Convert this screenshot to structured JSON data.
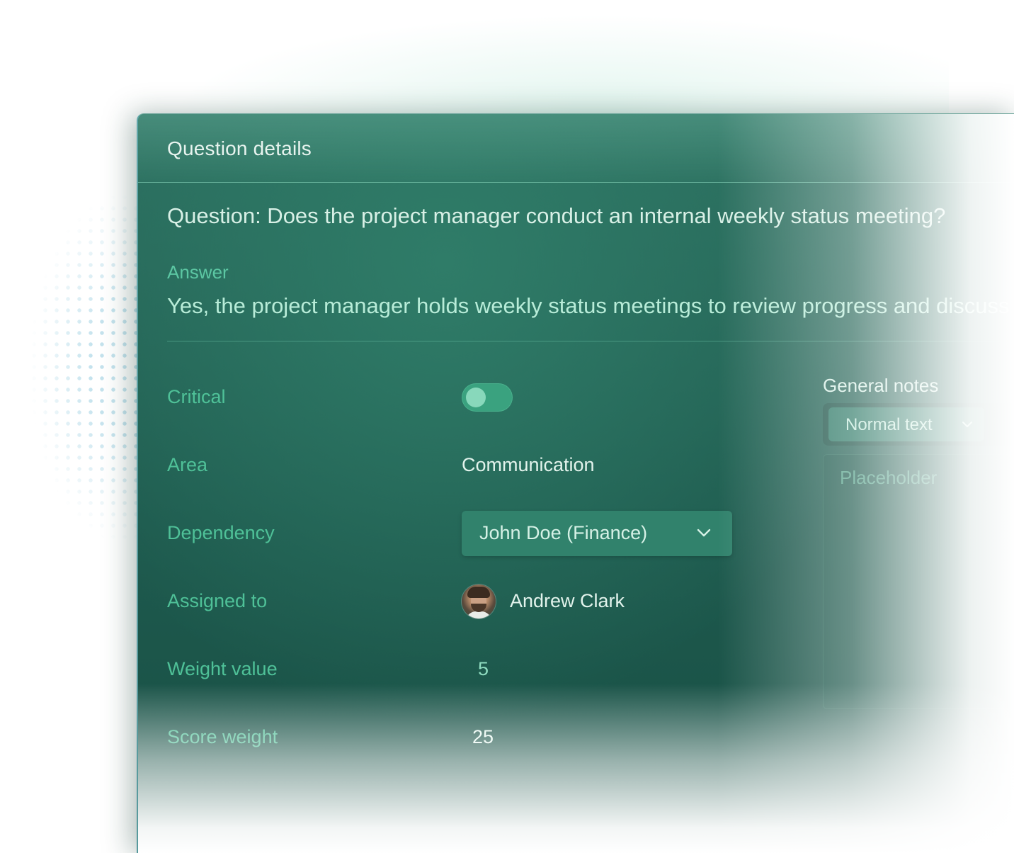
{
  "panel": {
    "title": "Question details"
  },
  "question": {
    "text": "Question: Does the project manager conduct an internal weekly status meeting?"
  },
  "answer": {
    "label": "Answer",
    "text": "Yes, the project manager holds weekly status meetings to review progress and discuss"
  },
  "fields": {
    "critical": {
      "label": "Critical",
      "enabled": true
    },
    "area": {
      "label": "Area",
      "value": "Communication"
    },
    "dependency": {
      "label": "Dependency",
      "value": "John Doe (Finance)"
    },
    "assigned_to": {
      "label": "Assigned to",
      "name": "Andrew Clark"
    },
    "weight_value": {
      "label": "Weight value",
      "value": "5"
    },
    "score_weight": {
      "label": "Score weight",
      "value": "25"
    }
  },
  "notes": {
    "label": "General notes",
    "format_option": "Normal text",
    "placeholder": "Placeholder"
  },
  "colors": {
    "accent": "#4fc198",
    "card_background": "#246653",
    "toggle_on": "#3aa27f"
  },
  "icons": {
    "dependency_dropdown": "chevron-down-icon",
    "format_dropdown": "chevron-down-icon"
  }
}
